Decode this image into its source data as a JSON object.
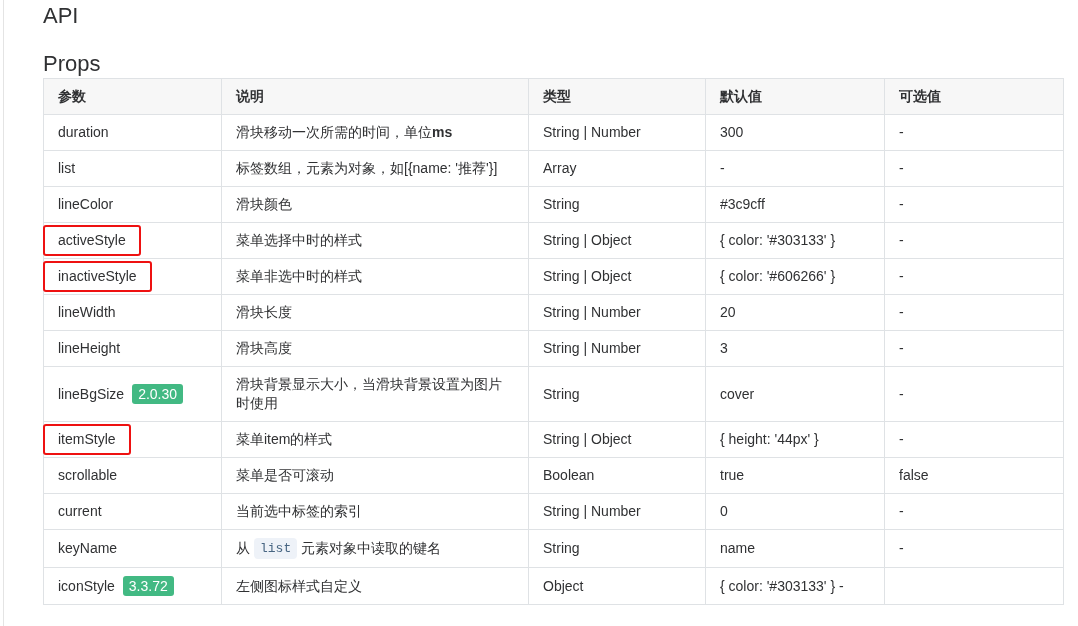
{
  "page_title": "API",
  "section_title": "Props",
  "table": {
    "columns": [
      "参数",
      "说明",
      "类型",
      "默认值",
      "可选值"
    ],
    "rows": [
      {
        "name": "duration",
        "highlighted": false,
        "description": "滑块移动一次所需的时间，单位**ms**",
        "type": "String | Number",
        "default": "300",
        "options": "-"
      },
      {
        "name": "list",
        "highlighted": false,
        "description": "标签数组，元素为对象，如[{name: '推荐'}]",
        "type": "Array",
        "default": "-",
        "options": "-"
      },
      {
        "name": "lineColor",
        "highlighted": false,
        "description": "滑块颜色",
        "type": "String",
        "default": "#3c9cff",
        "options": "-"
      },
      {
        "name": "activeStyle",
        "highlighted": true,
        "description": "菜单选择中时的样式",
        "type": "String | Object",
        "default": "{ color: '#303133' }",
        "options": "-"
      },
      {
        "name": "inactiveStyle",
        "highlighted": true,
        "description": "菜单非选中时的样式",
        "type": "String | Object",
        "default": "{ color: '#606266' }",
        "options": "-"
      },
      {
        "name": "lineWidth",
        "highlighted": false,
        "description": "滑块长度",
        "type": "String | Number",
        "default": "20",
        "options": "-"
      },
      {
        "name": "lineHeight",
        "highlighted": false,
        "description": "滑块高度",
        "type": "String | Number",
        "default": "3",
        "options": "-"
      },
      {
        "name": "lineBgSize",
        "version": "2.0.30",
        "highlighted": false,
        "description": "滑块背景显示大小，当滑块背景设置为图片时使用",
        "type": "String",
        "default": "cover",
        "options": "-"
      },
      {
        "name": "itemStyle",
        "highlighted": true,
        "description": "菜单item的样式",
        "type": "String | Object",
        "default": "{ height: '44px' }",
        "options": "-"
      },
      {
        "name": "scrollable",
        "highlighted": false,
        "description": "菜单是否可滚动",
        "type": "Boolean",
        "default": "true",
        "options": "false"
      },
      {
        "name": "current",
        "highlighted": false,
        "description": "当前选中标签的索引",
        "type": "String | Number",
        "default": "0",
        "options": "-"
      },
      {
        "name": "keyName",
        "highlighted": false,
        "description": [
          {
            "kind": "text",
            "text": "从"
          },
          {
            "kind": "code",
            "text": "list"
          },
          {
            "kind": "text",
            "text": "元素对象中读取的键名"
          }
        ],
        "type": "String",
        "default": "name",
        "options": "-"
      },
      {
        "name": "iconStyle",
        "version": "3.3.72",
        "highlighted": false,
        "description": "左侧图标样式自定义",
        "type": "Object",
        "default": "{ color: '#303133' } -"
      }
    ]
  }
}
